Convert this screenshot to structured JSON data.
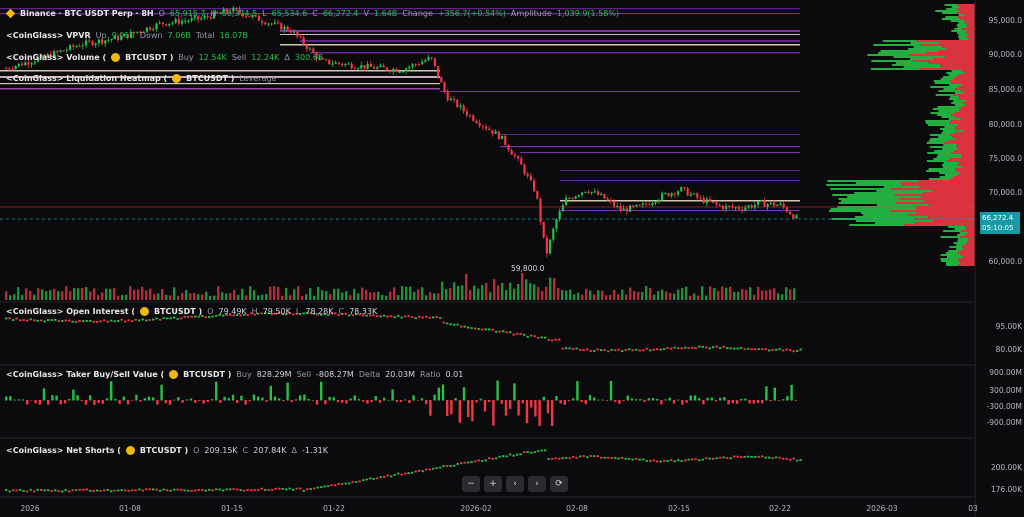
{
  "main_legend": {
    "title": "Binance · BTC USDT Perp · 8H",
    "o_key": "O",
    "o_val": "65,915.7",
    "h_key": "H",
    "h_val": "66,374.5",
    "l_key": "L",
    "l_val": "65,534.6",
    "c_key": "C",
    "c_val": "66,272.4",
    "v_key": "V",
    "v_val": "1.64B",
    "change_key": "Change",
    "change_val": "+356.7(+0.54%)",
    "amp_key": "Amplitude",
    "amp_val": "1,039.9(1.58%)"
  },
  "vpvr_legend": {
    "title": "<CoinGlass> VPVR",
    "up_key": "Up",
    "up_val": "9.01B",
    "down_key": "Down",
    "down_val": "7.06B",
    "total_key": "Total",
    "total_val": "16.07B"
  },
  "volume_legend": {
    "title": "<CoinGlass> Volume (",
    "symbol": "BTCUSDT )",
    "buy_key": "Buy",
    "buy_val": "12.54K",
    "sell_key": "Sell",
    "sell_val": "12.24K",
    "extra_key": "Δ",
    "extra_val": "300.68"
  },
  "heatmap_legend": {
    "title": "<CoinGlass> Liquidation Heatmap (",
    "symbol": "BTCUSDT )",
    "param": "Leverage"
  },
  "oi_legend": {
    "title": "<CoinGlass> Open Interest (",
    "symbol": "BTCUSDT )",
    "o_key": "O",
    "o_val": "79.49K",
    "h_key": "H",
    "h_val": "79.50K",
    "l_key": "L",
    "l_val": "78.28K",
    "c_key": "C",
    "c_val": "78.33K"
  },
  "taker_legend": {
    "title": "<CoinGlass> Taker Buy/Sell Value (",
    "symbol": "BTCUSDT )",
    "buy_key": "Buy",
    "buy_val": "828.29M",
    "sell_key": "Sell",
    "sell_val": "-808.27M",
    "delta_key": "Delta",
    "delta_val": "20.03M",
    "ratio_key": "Ratio",
    "ratio_val": "0.01"
  },
  "ns_legend": {
    "title": "<CoinGlass> Net Shorts (",
    "symbol": "BTCUSDT )",
    "o_key": "O",
    "o_val": "209.15K",
    "c_key": "C",
    "c_val": "207.84K",
    "d_key": "Δ",
    "d_val": "-1.31K"
  },
  "price_axis": [
    "95,000.0",
    "90,000.0",
    "85,000.0",
    "80,000.0",
    "75,000.0",
    "70,000.0",
    "60,000.0"
  ],
  "oi_axis": [
    "95.00K",
    "80.00K"
  ],
  "taker_axis": [
    "900.00M",
    "300.00M",
    "-300.00M",
    "-900.00M"
  ],
  "ns_axis": [
    "200.00K",
    "176.00K"
  ],
  "current_price": "66,272.4",
  "countdown": "05:10:05",
  "low_label": "59,800.0",
  "time_axis": [
    "2026",
    "01-08",
    "01-15",
    "01-22",
    "2026-02",
    "02-08",
    "02-15",
    "02-22",
    "2026-03",
    "03"
  ],
  "toolbar": {
    "zoom_out": "−",
    "zoom_in": "+",
    "prev": "‹",
    "next": "›",
    "reset": "⟳"
  },
  "colors": {
    "up": "#26c046",
    "down": "#f23645",
    "heat": "#7b2fb5",
    "heat_hot": "#f5e6c8",
    "accent": "#189aa6"
  }
}
